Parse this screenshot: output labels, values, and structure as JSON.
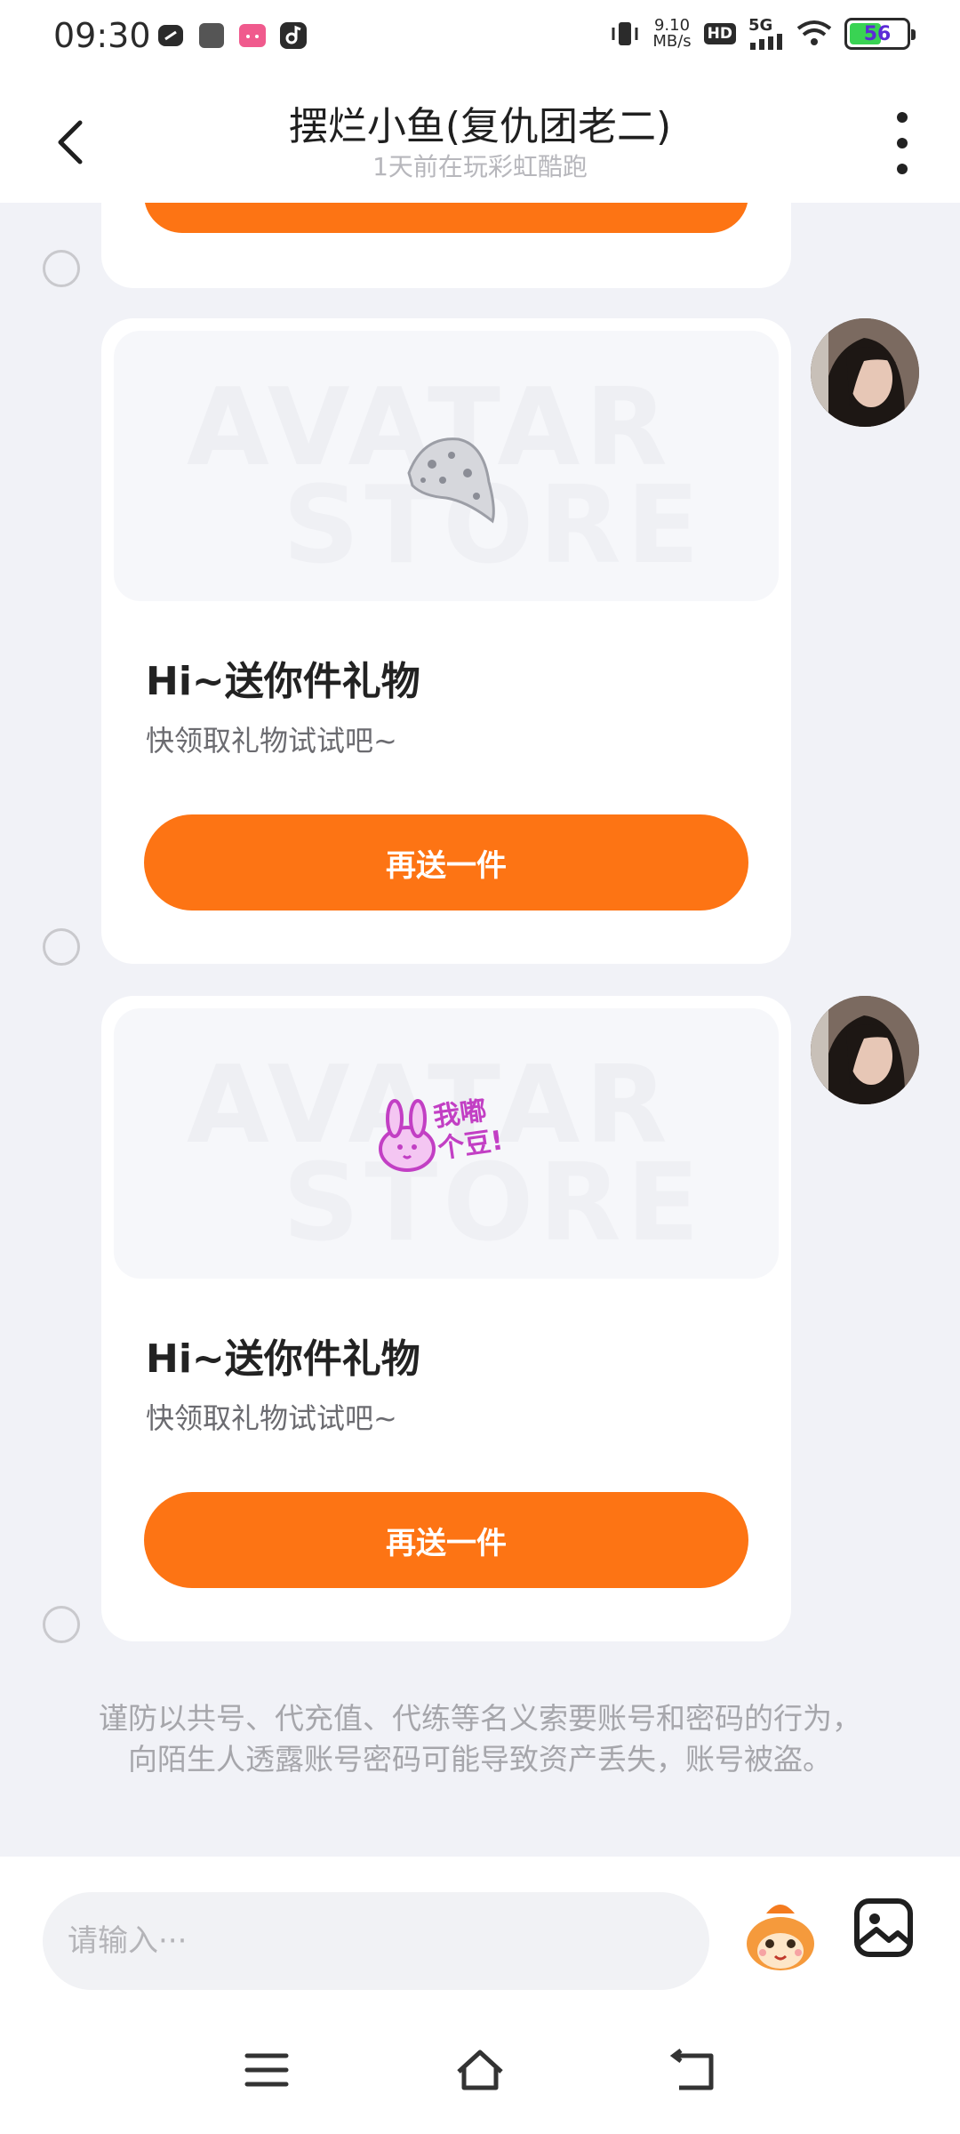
{
  "status_bar": {
    "time": "09:30",
    "net_speed_value": "9.10",
    "net_speed_unit": "MB/s",
    "hd_label": "HD",
    "signal_label": "5G",
    "battery_level": "56",
    "battery_fraction": 0.56
  },
  "header": {
    "title": "摆烂小鱼(复仇团老二)",
    "subtitle": "1天前在玩彩虹酷跑"
  },
  "messages": [
    {
      "title": "Hi~送你件礼物",
      "desc": "快领取礼物试试吧~",
      "button": "再送一件",
      "watermark_top": "AVATAR",
      "watermark_bottom": "STORE",
      "gift_icon": "hat-icon"
    },
    {
      "title": "Hi~送你件礼物",
      "desc": "快领取礼物试试吧~",
      "button": "再送一件",
      "watermark_top": "AVATAR",
      "watermark_bottom": "STORE",
      "gift_icon": "bunny-sticker-icon",
      "sticker_text": "我嘟个豆!"
    }
  ],
  "warning": "谨防以共号、代充值、代练等名义索要账号和密码的行为，向陌生人透露账号密码可能导致资产丢失，账号被盗。",
  "input": {
    "placeholder": "请输入···"
  },
  "colors": {
    "accent": "#fd7414",
    "background": "#f1f2f7"
  }
}
